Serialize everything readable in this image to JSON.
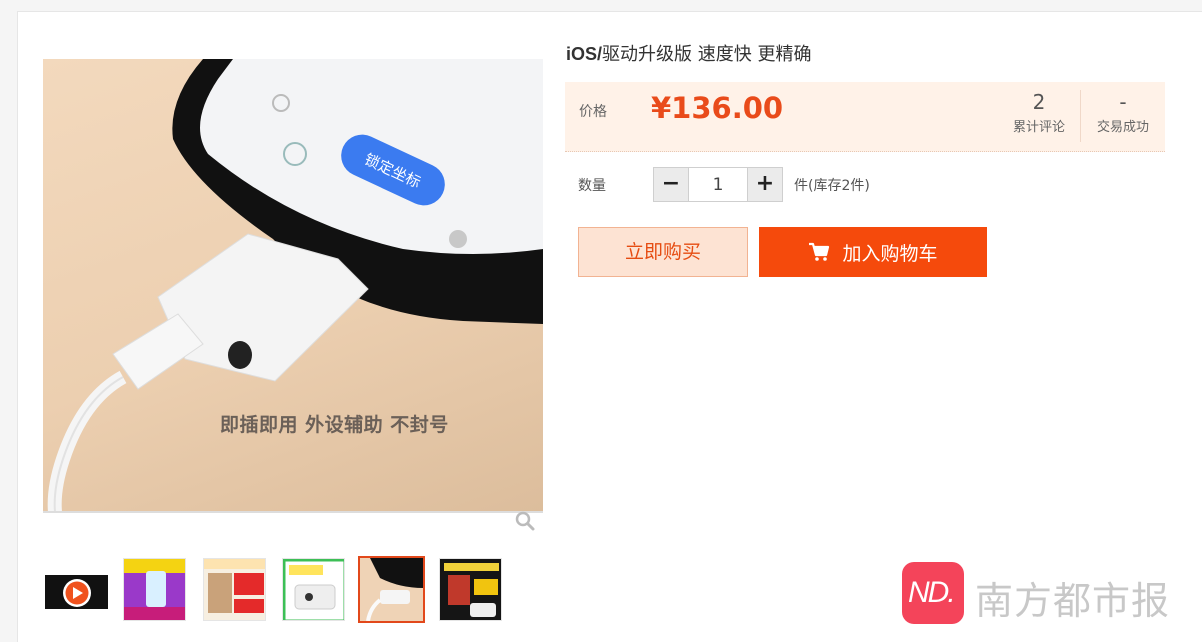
{
  "product": {
    "title_brand": "iOS/",
    "title_rest": "驱动升级版 速度快 更精确",
    "image_slogan": "即插即用 外设辅助 不封号",
    "screen_button_text": "锁定坐标"
  },
  "price_box": {
    "price_label": "价格",
    "price_value": "¥136.00",
    "reviews_count": "2",
    "reviews_label": "累计评论",
    "trades_count": "-",
    "trades_label": "交易成功"
  },
  "quantity": {
    "label": "数量",
    "minus": "−",
    "value": "1",
    "plus": "+",
    "stock_text": "件(库存2件)"
  },
  "actions": {
    "buy_now": "立即购买",
    "add_to_cart": "加入购物车"
  },
  "thumbnails": [
    {
      "kind": "video",
      "name": "video-thumbnail"
    },
    {
      "kind": "image",
      "name": "thumbnail-2"
    },
    {
      "kind": "image",
      "name": "thumbnail-3"
    },
    {
      "kind": "image",
      "name": "thumbnail-4"
    },
    {
      "kind": "image",
      "name": "thumbnail-5",
      "active": true
    },
    {
      "kind": "image",
      "name": "thumbnail-6"
    }
  ],
  "watermark": {
    "logo_text": "ND.",
    "text": "南方都市报"
  },
  "colors": {
    "accent": "#f54a0c",
    "price": "#e94b1a",
    "price_bg": "#fff2e8",
    "buy_now_bg": "#fde3d3"
  },
  "icons": [
    "search-zoom-icon",
    "cart-icon",
    "play-icon"
  ]
}
